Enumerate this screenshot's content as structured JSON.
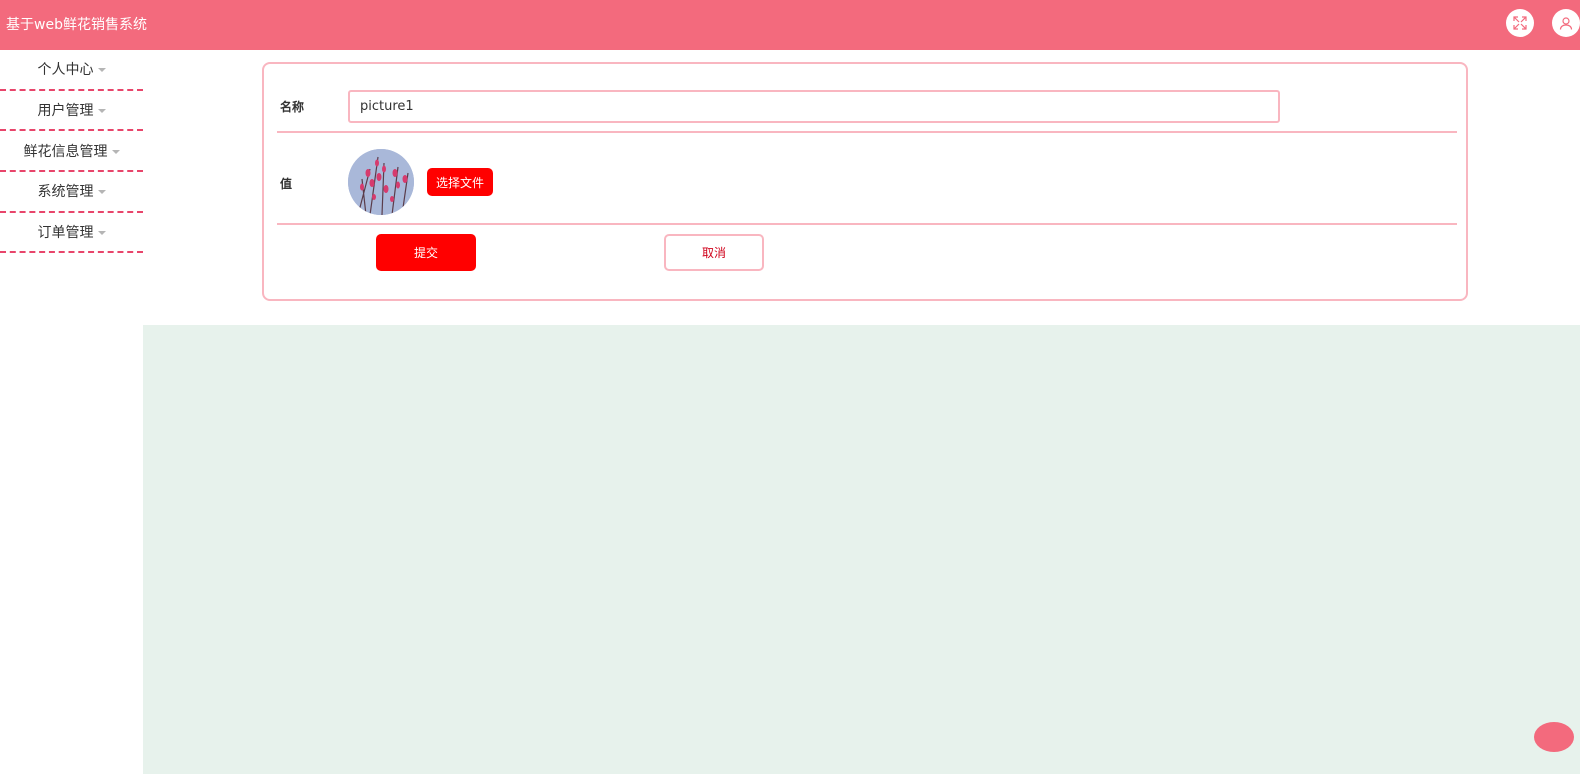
{
  "header": {
    "title": "基于web鲜花销售系统",
    "fullscreen_icon": "fullscreen-icon",
    "user_icon": "user-icon"
  },
  "sidebar": {
    "items": [
      {
        "label": "个人中心"
      },
      {
        "label": "用户管理"
      },
      {
        "label": "鲜花信息管理"
      },
      {
        "label": "系统管理"
      },
      {
        "label": "订单管理"
      }
    ]
  },
  "form": {
    "name_label": "名称",
    "name_value": "picture1",
    "value_label": "值",
    "choose_file_label": "选择文件",
    "submit_label": "提交",
    "cancel_label": "取消"
  },
  "colors": {
    "header_bg": "#f36a7d",
    "accent_red": "#ff0000",
    "border_pink": "#f9b6c0",
    "content_bg": "#e7f2ec"
  }
}
